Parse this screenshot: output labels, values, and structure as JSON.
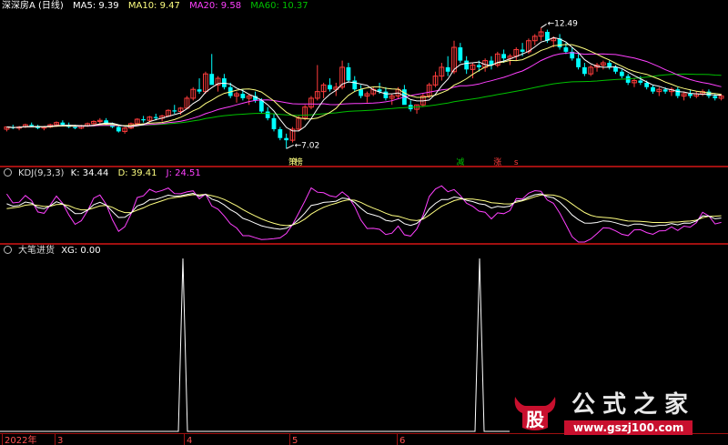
{
  "main_header": {
    "stock_name": "深深房A (日线)",
    "ma5": "MA5: 9.39",
    "ma10": "MA10: 9.47",
    "ma20": "MA20: 9.58",
    "ma60": "MA60: 10.37"
  },
  "kdj_header": {
    "name": "KDJ(9,3,3)",
    "k": "K: 34.44",
    "d": "D: 39.41",
    "j": "J: 24.51"
  },
  "xg_header": {
    "name": "大笔进货",
    "xg": "XG: 0.00"
  },
  "colors": {
    "up": "#ff3c3c",
    "down": "#00ffff",
    "ma5": "#ffffff",
    "ma10": "#ffff80",
    "ma20": "#ff40ff",
    "ma60": "#00c000",
    "separator": "#a01010",
    "k": "#ffffff",
    "d": "#ffff80",
    "j": "#ff40ff",
    "xg": "#ffffff"
  },
  "watermark": {
    "logo": "股",
    "title": "公式之家",
    "url": "www.gszj100.com"
  },
  "chart_data": [
    {
      "type": "candlestick",
      "title": "深深房A (日线)",
      "indicators": [
        "MA5",
        "MA10",
        "MA20",
        "MA60"
      ],
      "annotations": [
        {
          "label": "7.02",
          "kind": "low"
        },
        {
          "label": "12.49",
          "kind": "high"
        }
      ],
      "event_labels": [
        {
          "text": "策",
          "color": "#ffff80"
        },
        {
          "text": "榜",
          "color": "#ffff80"
        },
        {
          "text": "减",
          "color": "#00c000"
        },
        {
          "text": "涨",
          "color": "#ff3c3c"
        },
        {
          "text": "s",
          "color": "#ff3c3c"
        }
      ],
      "ylim": [
        6.5,
        13
      ],
      "candles": [
        [
          7.9,
          8.0,
          7.8,
          8.0
        ],
        [
          8.0,
          8.1,
          7.9,
          7.95
        ],
        [
          7.95,
          8.05,
          7.85,
          8.0
        ],
        [
          8.0,
          8.15,
          7.95,
          8.1
        ],
        [
          8.1,
          8.2,
          8.0,
          8.05
        ],
        [
          8.05,
          8.1,
          7.9,
          7.95
        ],
        [
          7.95,
          8.05,
          7.85,
          8.0
        ],
        [
          8.0,
          8.15,
          7.95,
          8.1
        ],
        [
          8.1,
          8.25,
          8.0,
          8.2
        ],
        [
          8.2,
          8.3,
          8.05,
          8.1
        ],
        [
          8.1,
          8.2,
          7.95,
          8.0
        ],
        [
          8.0,
          8.1,
          7.9,
          7.95
        ],
        [
          7.95,
          8.1,
          7.9,
          8.05
        ],
        [
          8.05,
          8.2,
          8.0,
          8.15
        ],
        [
          8.15,
          8.3,
          8.05,
          8.25
        ],
        [
          8.25,
          8.4,
          8.15,
          8.3
        ],
        [
          8.3,
          8.4,
          8.1,
          8.15
        ],
        [
          8.15,
          8.2,
          7.95,
          8.0
        ],
        [
          8.0,
          8.05,
          7.75,
          7.8
        ],
        [
          7.8,
          8.0,
          7.7,
          7.95
        ],
        [
          7.95,
          8.2,
          7.9,
          8.15
        ],
        [
          8.15,
          8.4,
          8.1,
          8.35
        ],
        [
          8.35,
          8.5,
          8.2,
          8.3
        ],
        [
          8.3,
          8.5,
          8.2,
          8.45
        ],
        [
          8.45,
          8.6,
          8.3,
          8.4
        ],
        [
          8.4,
          8.55,
          8.25,
          8.5
        ],
        [
          8.5,
          8.8,
          8.45,
          8.75
        ],
        [
          8.75,
          9.0,
          8.6,
          8.7
        ],
        [
          8.7,
          8.9,
          8.55,
          8.85
        ],
        [
          8.85,
          9.4,
          8.8,
          9.3
        ],
        [
          9.3,
          9.8,
          9.2,
          9.7
        ],
        [
          9.7,
          10.2,
          9.5,
          9.6
        ],
        [
          9.6,
          10.5,
          9.5,
          10.4
        ],
        [
          10.4,
          11.3,
          10.1,
          9.9
        ],
        [
          9.9,
          10.3,
          9.6,
          10.2
        ],
        [
          10.2,
          10.4,
          9.7,
          9.8
        ],
        [
          9.8,
          10.0,
          9.3,
          9.4
        ],
        [
          9.4,
          9.6,
          9.1,
          9.5
        ],
        [
          9.5,
          9.7,
          9.2,
          9.3
        ],
        [
          9.3,
          9.5,
          9.0,
          9.4
        ],
        [
          9.4,
          9.6,
          9.1,
          9.2
        ],
        [
          9.2,
          9.3,
          8.6,
          8.7
        ],
        [
          8.7,
          8.9,
          8.3,
          8.4
        ],
        [
          8.4,
          8.6,
          7.8,
          7.9
        ],
        [
          7.9,
          8.0,
          7.4,
          7.5
        ],
        [
          7.5,
          7.7,
          7.02,
          7.4
        ],
        [
          7.4,
          8.0,
          7.3,
          7.9
        ],
        [
          7.9,
          8.5,
          7.8,
          8.4
        ],
        [
          8.4,
          9.0,
          8.3,
          8.9
        ],
        [
          8.9,
          9.4,
          8.8,
          9.3
        ],
        [
          9.3,
          10.8,
          9.2,
          9.6
        ],
        [
          9.6,
          10.0,
          9.3,
          9.9
        ],
        [
          9.9,
          10.2,
          9.6,
          9.7
        ],
        [
          9.7,
          10.0,
          9.4,
          9.8
        ],
        [
          9.8,
          11.0,
          9.7,
          10.7
        ],
        [
          10.7,
          10.9,
          10.0,
          10.1
        ],
        [
          10.1,
          10.3,
          9.6,
          9.7
        ],
        [
          9.7,
          9.9,
          9.3,
          9.4
        ],
        [
          9.4,
          9.6,
          9.1,
          9.5
        ],
        [
          9.5,
          9.8,
          9.4,
          9.7
        ],
        [
          9.7,
          10.0,
          9.5,
          9.6
        ],
        [
          9.6,
          9.8,
          9.2,
          9.3
        ],
        [
          9.3,
          9.5,
          9.0,
          9.4
        ],
        [
          9.4,
          9.8,
          9.3,
          9.7
        ],
        [
          9.7,
          9.9,
          9.2,
          9.0
        ],
        [
          9.0,
          9.2,
          8.7,
          8.8
        ],
        [
          8.8,
          9.0,
          8.6,
          9.0
        ],
        [
          9.0,
          9.5,
          8.9,
          9.4
        ],
        [
          9.4,
          10.0,
          9.3,
          9.9
        ],
        [
          9.9,
          10.5,
          9.8,
          10.3
        ],
        [
          10.3,
          10.9,
          10.1,
          10.7
        ],
        [
          10.7,
          11.2,
          10.3,
          10.5
        ],
        [
          10.5,
          11.9,
          10.4,
          11.6
        ],
        [
          11.6,
          11.8,
          10.9,
          11.0
        ],
        [
          11.0,
          11.2,
          10.4,
          10.6
        ],
        [
          10.6,
          10.9,
          10.2,
          10.8
        ],
        [
          10.8,
          11.0,
          10.5,
          10.7
        ],
        [
          10.7,
          11.1,
          10.5,
          11.0
        ],
        [
          11.0,
          11.2,
          10.6,
          10.8
        ],
        [
          10.8,
          11.4,
          10.7,
          11.3
        ],
        [
          11.3,
          11.5,
          10.9,
          11.1
        ],
        [
          11.1,
          11.3,
          10.8,
          11.2
        ],
        [
          11.2,
          11.6,
          11.0,
          11.5
        ],
        [
          11.5,
          11.8,
          11.2,
          11.4
        ],
        [
          11.4,
          12.0,
          11.3,
          11.9
        ],
        [
          11.9,
          12.2,
          11.7,
          12.1
        ],
        [
          12.1,
          12.49,
          11.9,
          12.3
        ],
        [
          12.3,
          12.4,
          11.8,
          11.9
        ],
        [
          11.9,
          12.1,
          11.6,
          12.0
        ],
        [
          12.0,
          12.2,
          11.5,
          11.6
        ],
        [
          11.6,
          11.8,
          11.3,
          11.4
        ],
        [
          11.4,
          11.6,
          11.0,
          11.1
        ],
        [
          11.1,
          11.3,
          10.6,
          10.7
        ],
        [
          10.7,
          10.9,
          10.3,
          10.4
        ],
        [
          10.4,
          10.8,
          10.3,
          10.7
        ],
        [
          10.7,
          10.9,
          10.5,
          10.8
        ],
        [
          10.8,
          11.0,
          10.6,
          10.9
        ],
        [
          10.9,
          11.0,
          10.6,
          10.7
        ],
        [
          10.7,
          10.8,
          10.4,
          10.5
        ],
        [
          10.5,
          10.6,
          10.2,
          10.3
        ],
        [
          10.3,
          10.4,
          9.9,
          10.0
        ],
        [
          10.0,
          10.2,
          9.8,
          10.1
        ],
        [
          10.1,
          10.3,
          9.9,
          10.0
        ],
        [
          10.0,
          10.1,
          9.7,
          9.8
        ],
        [
          9.8,
          9.9,
          9.5,
          9.6
        ],
        [
          9.6,
          9.8,
          9.4,
          9.7
        ],
        [
          9.7,
          9.8,
          9.5,
          9.6
        ],
        [
          9.6,
          9.8,
          9.4,
          9.7
        ],
        [
          9.7,
          9.8,
          9.3,
          9.4
        ],
        [
          9.4,
          9.6,
          9.2,
          9.5
        ],
        [
          9.5,
          9.7,
          9.3,
          9.4
        ],
        [
          9.4,
          9.6,
          9.3,
          9.5
        ],
        [
          9.5,
          9.7,
          9.4,
          9.6
        ],
        [
          9.6,
          9.7,
          9.3,
          9.4
        ],
        [
          9.4,
          9.5,
          9.2,
          9.3
        ],
        [
          9.3,
          9.5,
          9.2,
          9.4
        ]
      ]
    },
    {
      "type": "line",
      "title": "KDJ(9,3,3)",
      "series": [
        {
          "name": "K",
          "values": [
            34.44
          ]
        },
        {
          "name": "D",
          "values": [
            39.41
          ]
        },
        {
          "name": "J",
          "values": [
            24.51
          ]
        }
      ]
    },
    {
      "type": "line",
      "title": "大笔进货",
      "series": [
        {
          "name": "XG",
          "values": [
            0,
            0,
            0,
            0,
            0,
            0,
            0,
            0,
            0,
            0,
            0,
            0,
            0,
            0,
            0,
            0,
            0,
            0,
            0,
            0,
            0,
            0,
            0,
            0,
            0,
            0,
            0,
            0,
            0,
            0,
            0,
            0,
            0,
            0,
            0,
            0,
            0,
            0,
            0,
            0,
            0,
            0,
            0,
            0,
            0,
            0,
            0,
            0,
            0,
            0,
            0,
            0,
            0,
            0,
            0,
            0,
            0,
            0,
            0,
            0,
            0,
            0,
            0,
            0,
            0,
            0,
            0,
            0,
            0,
            0,
            0,
            0,
            0,
            0,
            0,
            0,
            0,
            0,
            0,
            0,
            0,
            0,
            0,
            0,
            0,
            0,
            0,
            0,
            0,
            0,
            0,
            0,
            0,
            0,
            0,
            0,
            0,
            0,
            0,
            0,
            0,
            0,
            0,
            0,
            0,
            0,
            0,
            0,
            0,
            0,
            0,
            0,
            0,
            0,
            0,
            0
          ]
        }
      ],
      "spikes": [
        {
          "x_label": "4",
          "value": 1
        },
        {
          "x_label": "6",
          "value": 1
        }
      ],
      "x_tick_labels": [
        "2022年",
        "3",
        "4",
        "5",
        "6"
      ],
      "ylim": [
        0,
        1
      ]
    }
  ]
}
